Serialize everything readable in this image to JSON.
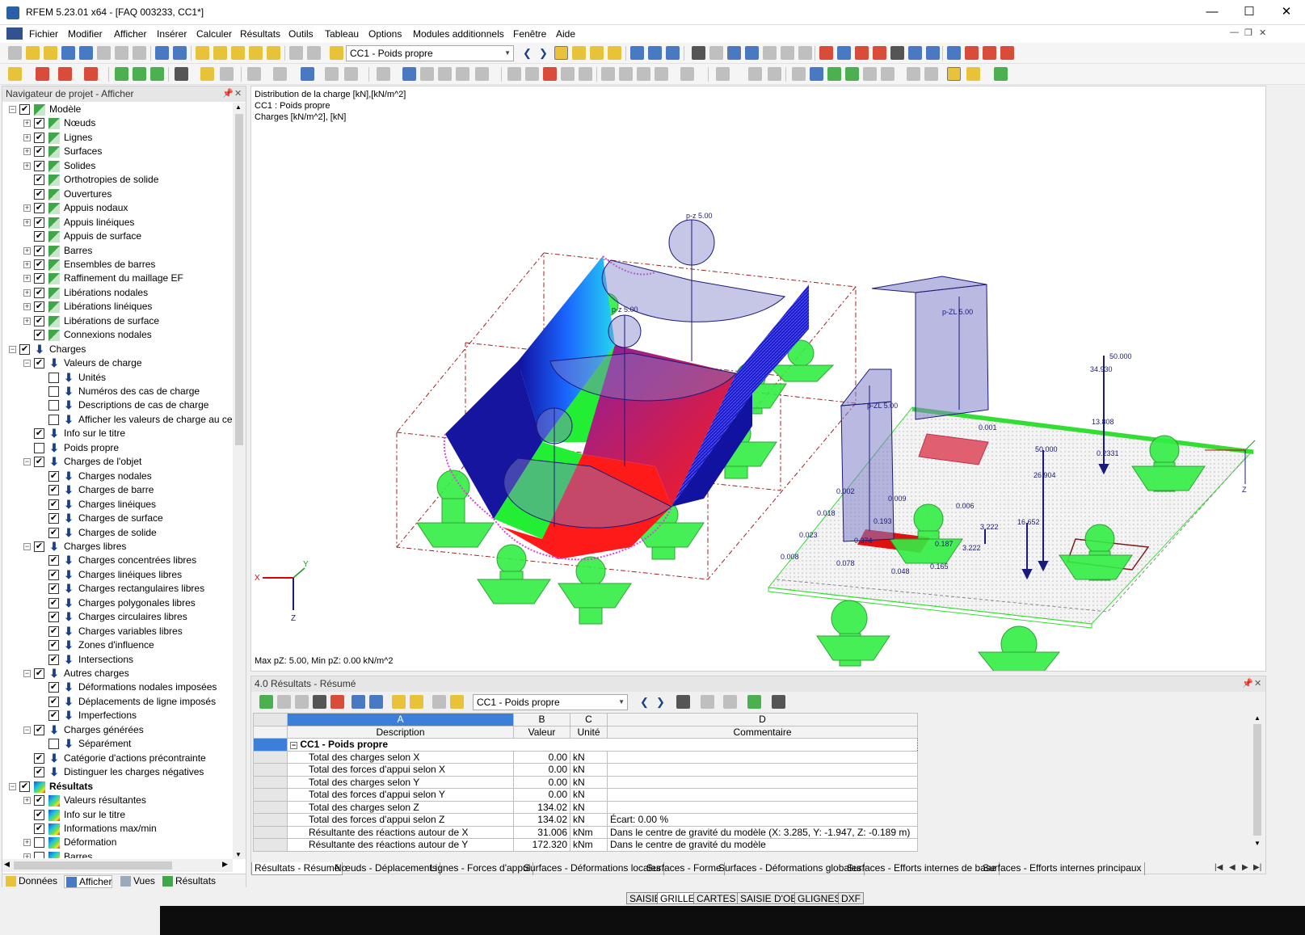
{
  "window": {
    "title": "RFEM 5.23.01 x64 - [FAQ 003233, CC1*]"
  },
  "menu": [
    "Fichier",
    "Modifier",
    "Afficher",
    "Insérer",
    "Calculer",
    "Résultats",
    "Outils",
    "Tableau",
    "Options",
    "Modules additionnels",
    "Fenêtre",
    "Aide"
  ],
  "toolbar": {
    "loadcase_selected": "CC1 - Poids propre"
  },
  "navigator": {
    "title": "Navigateur de projet - Afficher",
    "items": [
      {
        "label": "Modèle",
        "level": 0,
        "exp": "-",
        "check": true,
        "icon": "model"
      },
      {
        "label": "Nœuds",
        "level": 1,
        "exp": "+",
        "check": true,
        "icon": "model"
      },
      {
        "label": "Lignes",
        "level": 1,
        "exp": "+",
        "check": true,
        "icon": "model"
      },
      {
        "label": "Surfaces",
        "level": 1,
        "exp": "+",
        "check": true,
        "icon": "model"
      },
      {
        "label": "Solides",
        "level": 1,
        "exp": "+",
        "check": true,
        "icon": "model"
      },
      {
        "label": "Orthotropies de solide",
        "level": 1,
        "exp": "",
        "check": true,
        "icon": "model"
      },
      {
        "label": "Ouvertures",
        "level": 1,
        "exp": "",
        "check": true,
        "icon": "model"
      },
      {
        "label": "Appuis nodaux",
        "level": 1,
        "exp": "+",
        "check": true,
        "icon": "model"
      },
      {
        "label": "Appuis linéiques",
        "level": 1,
        "exp": "+",
        "check": true,
        "icon": "model"
      },
      {
        "label": "Appuis de surface",
        "level": 1,
        "exp": "",
        "check": true,
        "icon": "model"
      },
      {
        "label": "Barres",
        "level": 1,
        "exp": "+",
        "check": true,
        "icon": "model"
      },
      {
        "label": "Ensembles de barres",
        "level": 1,
        "exp": "+",
        "check": true,
        "icon": "model"
      },
      {
        "label": "Raffinement du maillage EF",
        "level": 1,
        "exp": "+",
        "check": true,
        "icon": "model"
      },
      {
        "label": "Libérations nodales",
        "level": 1,
        "exp": "+",
        "check": true,
        "icon": "model"
      },
      {
        "label": "Libérations linéiques",
        "level": 1,
        "exp": "+",
        "check": true,
        "icon": "model"
      },
      {
        "label": "Libérations de surface",
        "level": 1,
        "exp": "+",
        "check": true,
        "icon": "model"
      },
      {
        "label": "Connexions nodales",
        "level": 1,
        "exp": "",
        "check": true,
        "icon": "model"
      },
      {
        "label": "Charges",
        "level": 0,
        "exp": "-",
        "check": true,
        "icon": "load"
      },
      {
        "label": "Valeurs de charge",
        "level": 1,
        "exp": "-",
        "check": true,
        "icon": "load"
      },
      {
        "label": "Unités",
        "level": 2,
        "exp": "",
        "check": false,
        "icon": "load"
      },
      {
        "label": "Numéros des cas de charge",
        "level": 2,
        "exp": "",
        "check": false,
        "icon": "load"
      },
      {
        "label": "Descriptions de cas de charge",
        "level": 2,
        "exp": "",
        "check": false,
        "icon": "load"
      },
      {
        "label": "Afficher les valeurs de charge au cen",
        "level": 2,
        "exp": "",
        "check": false,
        "icon": "load"
      },
      {
        "label": "Info sur le titre",
        "level": 1,
        "exp": "",
        "check": true,
        "icon": "load"
      },
      {
        "label": "Poids propre",
        "level": 1,
        "exp": "",
        "check": false,
        "icon": "load"
      },
      {
        "label": "Charges de l'objet",
        "level": 1,
        "exp": "-",
        "check": true,
        "icon": "load"
      },
      {
        "label": "Charges nodales",
        "level": 2,
        "exp": "",
        "check": true,
        "icon": "load"
      },
      {
        "label": "Charges de barre",
        "level": 2,
        "exp": "",
        "check": true,
        "icon": "load"
      },
      {
        "label": "Charges linéiques",
        "level": 2,
        "exp": "",
        "check": true,
        "icon": "load"
      },
      {
        "label": "Charges de surface",
        "level": 2,
        "exp": "",
        "check": true,
        "icon": "load"
      },
      {
        "label": "Charges de solide",
        "level": 2,
        "exp": "",
        "check": true,
        "icon": "load"
      },
      {
        "label": "Charges libres",
        "level": 1,
        "exp": "-",
        "check": true,
        "icon": "load"
      },
      {
        "label": "Charges concentrées libres",
        "level": 2,
        "exp": "",
        "check": true,
        "icon": "load"
      },
      {
        "label": "Charges linéiques libres",
        "level": 2,
        "exp": "",
        "check": true,
        "icon": "load"
      },
      {
        "label": "Charges rectangulaires libres",
        "level": 2,
        "exp": "",
        "check": true,
        "icon": "load"
      },
      {
        "label": "Charges polygonales libres",
        "level": 2,
        "exp": "",
        "check": true,
        "icon": "load"
      },
      {
        "label": "Charges circulaires libres",
        "level": 2,
        "exp": "",
        "check": true,
        "icon": "load"
      },
      {
        "label": "Charges variables libres",
        "level": 2,
        "exp": "",
        "check": true,
        "icon": "load"
      },
      {
        "label": "Zones d'influence",
        "level": 2,
        "exp": "",
        "check": true,
        "icon": "load"
      },
      {
        "label": "Intersections",
        "level": 2,
        "exp": "",
        "check": true,
        "icon": "load"
      },
      {
        "label": "Autres charges",
        "level": 1,
        "exp": "-",
        "check": true,
        "icon": "load"
      },
      {
        "label": "Déformations nodales imposées",
        "level": 2,
        "exp": "",
        "check": true,
        "icon": "load"
      },
      {
        "label": "Déplacements de ligne imposés",
        "level": 2,
        "exp": "",
        "check": true,
        "icon": "load"
      },
      {
        "label": "Imperfections",
        "level": 2,
        "exp": "",
        "check": true,
        "icon": "load"
      },
      {
        "label": "Charges générées",
        "level": 1,
        "exp": "-",
        "check": true,
        "icon": "load"
      },
      {
        "label": "Séparément",
        "level": 2,
        "exp": "",
        "check": false,
        "icon": "load"
      },
      {
        "label": "Catégorie d'actions précontrainte",
        "level": 1,
        "exp": "",
        "check": true,
        "icon": "load"
      },
      {
        "label": "Distinguer les charges négatives",
        "level": 1,
        "exp": "",
        "check": true,
        "icon": "load"
      },
      {
        "label": "Résultats",
        "level": 0,
        "exp": "-",
        "check": true,
        "icon": "res",
        "bold": true
      },
      {
        "label": "Valeurs résultantes",
        "level": 1,
        "exp": "+",
        "check": true,
        "icon": "res"
      },
      {
        "label": "Info sur le titre",
        "level": 1,
        "exp": "",
        "check": true,
        "icon": "res"
      },
      {
        "label": "Informations max/min",
        "level": 1,
        "exp": "",
        "check": true,
        "icon": "res"
      },
      {
        "label": "Déformation",
        "level": 1,
        "exp": "+",
        "check": false,
        "icon": "res"
      },
      {
        "label": "Barres",
        "level": 1,
        "exp": "+",
        "check": false,
        "icon": "res"
      }
    ],
    "tabs": [
      "Données",
      "Afficher",
      "Vues",
      "Résultats"
    ]
  },
  "viewport": {
    "info_lines": [
      "Distribution de la charge [kN],[kN/m^2]",
      "CC1 : Poids propre",
      "Charges [kN/m^2], [kN]"
    ],
    "footer": "Max pZ: 5.00, Min pZ: 0.00 kN/m^2",
    "labels": {
      "pz1": "p-z 5.00",
      "pz2": "p-z 5.00",
      "pzl1": "p-ZL 5.00",
      "pzl2": "p-ZL 5.00",
      "v50a": "50.000",
      "v34": "34.930",
      "v13": "13.808",
      "v0231": "0.2331",
      "v50b": "50.000",
      "v26": "26.904",
      "v16": "16.652",
      "v3222a": "3.222",
      "v3222b": "3.222",
      "v0002": "0.002",
      "v0009": "0.009",
      "v0006": "0.006",
      "v0018": "0.018",
      "v0023": "0.023",
      "v0008": "0.008",
      "v0193": "0.193",
      "v0374": "0.374",
      "v0187": "0.187",
      "v0078": "0.078",
      "v0048": "0.048",
      "v0165": "0.165",
      "v0001": "0.001"
    },
    "axis": {
      "x": "X",
      "y": "Y",
      "z": "Z"
    }
  },
  "results": {
    "title": "4.0 Résultats - Résumé",
    "loadcase": "CC1 - Poids propre",
    "col_letters": [
      "A",
      "B",
      "C",
      "D"
    ],
    "col_names": [
      "Description",
      "Valeur",
      "Unité",
      "Commentaire"
    ],
    "group": "CC1 - Poids propre",
    "rows": [
      {
        "desc": "Total des charges selon X",
        "val": "0.00",
        "unit": "kN",
        "comment": ""
      },
      {
        "desc": "Total des forces d'appui selon X",
        "val": "0.00",
        "unit": "kN",
        "comment": ""
      },
      {
        "desc": "Total des charges selon Y",
        "val": "0.00",
        "unit": "kN",
        "comment": ""
      },
      {
        "desc": "Total des forces d'appui selon Y",
        "val": "0.00",
        "unit": "kN",
        "comment": ""
      },
      {
        "desc": "Total des charges selon Z",
        "val": "134.02",
        "unit": "kN",
        "comment": ""
      },
      {
        "desc": "Total des forces d'appui selon Z",
        "val": "134.02",
        "unit": "kN",
        "comment": "Écart:  0.00 %"
      },
      {
        "desc": "Résultante des réactions autour de X",
        "val": "31.006",
        "unit": "kNm",
        "comment": "Dans le centre de gravité du modèle (X: 3.285, Y: -1.947, Z: -0.189 m)"
      },
      {
        "desc": "Résultante des réactions autour de Y",
        "val": "172.320",
        "unit": "kNm",
        "comment": "Dans le centre de gravité du modèle"
      }
    ],
    "tabs": [
      "Résultats - Résumé",
      "Nœuds - Déplacements",
      "Lignes - Forces d'appui",
      "Surfaces - Déformations locales",
      "Surfaces - Forme",
      "Surfaces - Déformations globales",
      "Surfaces - Efforts internes de base",
      "Surfaces - Efforts internes principaux"
    ]
  },
  "statusbar": [
    "SAISIE",
    "GRILLE",
    "CARTES",
    "SAISIE D'OB.",
    "GLIGNES",
    "DXF"
  ]
}
